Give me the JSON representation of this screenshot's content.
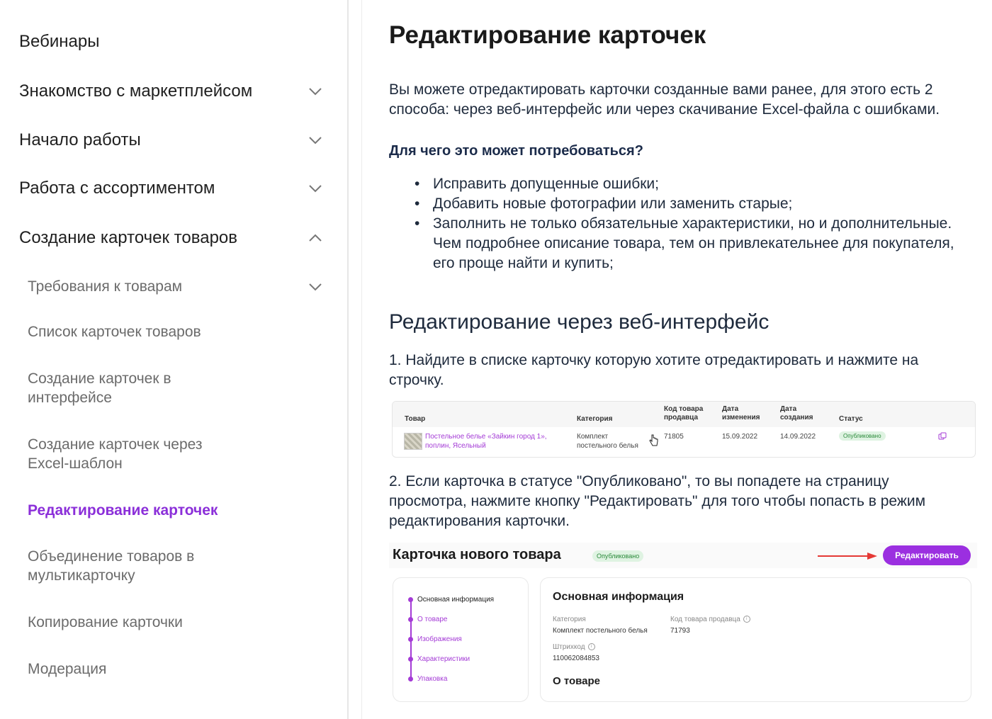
{
  "sidebar": {
    "items": [
      {
        "label": "Вебинары",
        "chevron": ""
      },
      {
        "label": "Знакомство с маркетплейсом",
        "chevron": "chevron-down-icon"
      },
      {
        "label": "Начало работы",
        "chevron": "chevron-down-icon"
      },
      {
        "label": "Работа с ассортиментом",
        "chevron": "chevron-down-icon"
      },
      {
        "label": "Создание карточек товаров",
        "chevron": "chevron-up-icon"
      }
    ],
    "sub_items": [
      {
        "label": "Требования к товарам",
        "chevron": "chevron-down-icon"
      },
      {
        "label": "Список карточек товаров"
      },
      {
        "label": "Создание карточек в интерфейсе"
      },
      {
        "label": "Создание карточек через Excel-шаблон"
      },
      {
        "label": "Редактирование карточек",
        "active": true
      },
      {
        "label": "Объединение товаров в мультикарточку"
      },
      {
        "label": "Копирование карточки"
      },
      {
        "label": "Модерация"
      }
    ],
    "active_color": "#8b2fd9"
  },
  "main": {
    "title": "Редактирование карточек",
    "intro": "Вы можете отредактировать карточки созданные вами ранее, для этого есть 2 способа: через веб-интерфейс или через скачивание Excel-файла с ошибками.",
    "why_heading": "Для чего это может потребоваться?",
    "bullets": [
      "Исправить допущенные ошибки;",
      "Добавить новые фотографии или заменить старые;",
      "Заполнить не только обязательные характеристики, но и дополнительные. Чем подробнее описание товара, тем он привлекательнее для покупателя, его проще найти и купить;"
    ],
    "section_heading": "Редактирование через веб-интерфейс",
    "step1": "1. Найдите в списке карточку которую хотите отредактировать и нажмите на строчку.",
    "step2": "2. Если карточка в статусе \"Опубликовано\", то вы попадете на страницу просмотра, нажмите кнопку \"Редактировать\" для того чтобы попасть в режим редактирования карточки."
  },
  "table_shot": {
    "headers": {
      "product": "Товар",
      "category": "Категория",
      "seller_code_1": "Код товара",
      "seller_code_2": "продавца",
      "modified_1": "Дата",
      "modified_2": "изменения",
      "created_1": "Дата",
      "created_2": "создания",
      "status": "Статус"
    },
    "row": {
      "product_1": "Постельное белье «Зайкин город 1»,",
      "product_2": "поплин, Ясельный",
      "category_1": "Комплект",
      "category_2": "постельного белья",
      "seller_code": "71805",
      "modified": "15.09.2022",
      "created": "14.09.2022",
      "status": "Опубликовано"
    }
  },
  "card_shot": {
    "title": "Карточка нового товара",
    "status": "Опубликовано",
    "edit_button": "Редактировать",
    "nav": [
      "Основная информация",
      "О товаре",
      "Изображения",
      "Характеристики",
      "Упаковка"
    ],
    "panel_title": "Основная информация",
    "category_label": "Категория",
    "category_value": "Комплект постельного белья",
    "seller_code_label": "Код товара продавца",
    "seller_code_value": "71793",
    "barcode_label": "Штрихкод",
    "barcode_value": "110062084853",
    "about_title": "О товаре",
    "accent": "#9b2fe0",
    "arrow_color": "#e53935"
  }
}
